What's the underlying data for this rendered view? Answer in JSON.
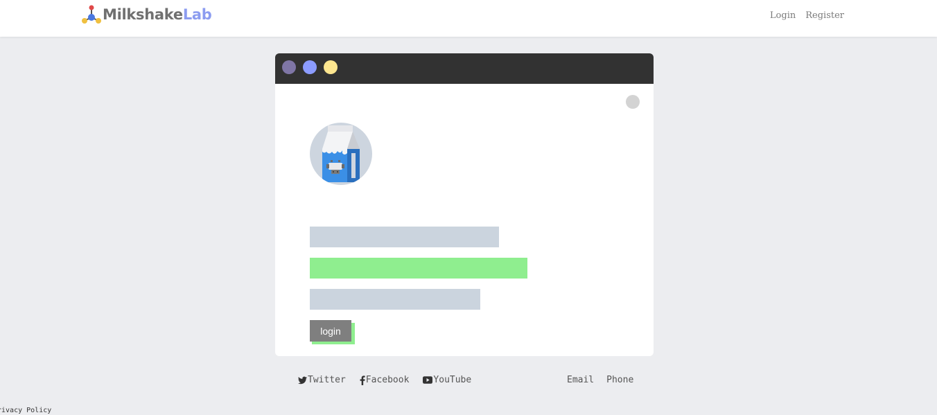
{
  "header": {
    "logo_part1": "Milkshake",
    "logo_part2": "Lab",
    "nav": {
      "login": "Login",
      "register": "Register"
    }
  },
  "window": {
    "traffic_lights": [
      "#7f76a6",
      "#8c9cff",
      "#fde68f"
    ],
    "avatar_icon": "milk-carton-icon",
    "bars": [
      {
        "color": "#cbd4de"
      },
      {
        "color": "#8fee8f"
      },
      {
        "color": "#cbd4de"
      }
    ],
    "login_button": "login"
  },
  "footer": {
    "social": [
      {
        "icon": "twitter-icon",
        "label": "Twitter"
      },
      {
        "icon": "facebook-icon",
        "label": "Facebook"
      },
      {
        "icon": "youtube-icon",
        "label": "YouTube"
      }
    ],
    "contact": {
      "email": "Email",
      "phone": "Phone"
    },
    "privacy": "rivacy Policy"
  },
  "colors": {
    "background": "#ecedf0",
    "accent": "#8c9cf0",
    "green": "#8fee8f"
  }
}
